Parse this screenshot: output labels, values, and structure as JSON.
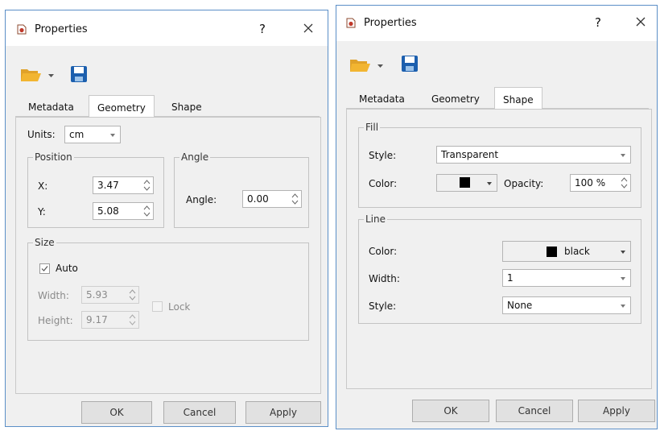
{
  "left_dialog": {
    "title": "Properties",
    "help": "?",
    "tabs": [
      "Metadata",
      "Geometry",
      "Shape"
    ],
    "active_tab": "Geometry",
    "units_label": "Units:",
    "units_value": "cm",
    "position": {
      "legend": "Position",
      "x_label": "X:",
      "x_value": "3.47",
      "y_label": "Y:",
      "y_value": "5.08"
    },
    "angle": {
      "legend": "Angle",
      "label": "Angle:",
      "value": "0.00"
    },
    "size": {
      "legend": "Size",
      "auto_label": "Auto",
      "auto_checked": true,
      "width_label": "Width:",
      "width_value": "5.93",
      "height_label": "Height:",
      "height_value": "9.17",
      "lock_label": "Lock",
      "lock_checked": false
    },
    "buttons": {
      "ok": "OK",
      "cancel": "Cancel",
      "apply": "Apply"
    }
  },
  "right_dialog": {
    "title": "Properties",
    "help": "?",
    "tabs": [
      "Metadata",
      "Geometry",
      "Shape"
    ],
    "active_tab": "Shape",
    "fill": {
      "legend": "Fill",
      "style_label": "Style:",
      "style_value": "Transparent",
      "color_label": "Color:",
      "color_value": "#000000",
      "opacity_label": "Opacity:",
      "opacity_value": "100 %"
    },
    "line": {
      "legend": "Line",
      "color_label": "Color:",
      "color_name": "black",
      "color_value": "#000000",
      "width_label": "Width:",
      "width_value": "1",
      "style_label": "Style:",
      "style_value": "None"
    },
    "buttons": {
      "ok": "OK",
      "cancel": "Cancel",
      "apply": "Apply"
    }
  },
  "colors": {
    "window_border": "#5b8fc7",
    "dialog_bg": "#f0f0f0",
    "folder_icon": "#f2b531",
    "save_icon": "#1c5fae",
    "title_icon": "#c0392b"
  },
  "icons": [
    "properties-app-icon",
    "close-icon",
    "open-folder-icon",
    "dropdown-arrow-icon",
    "save-icon",
    "spin-arrows-icon",
    "check-icon"
  ]
}
